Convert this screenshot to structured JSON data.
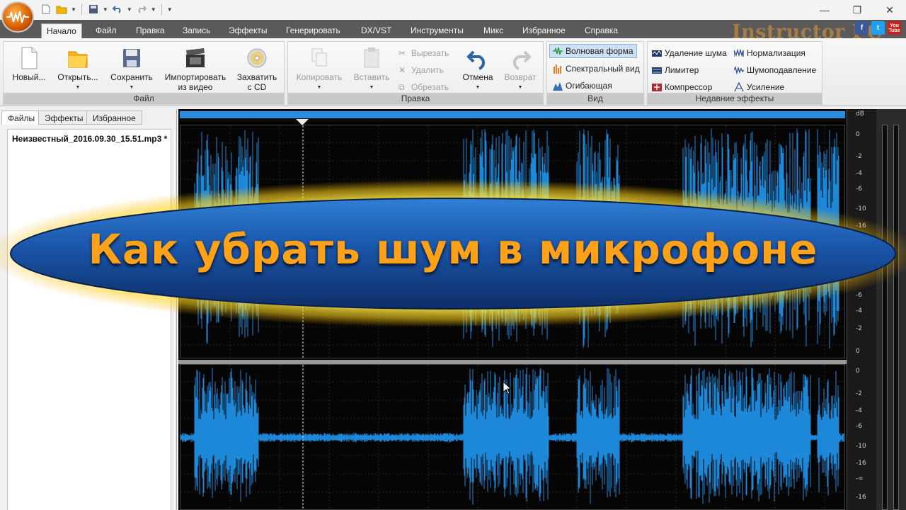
{
  "titlebar": {
    "window_controls": {
      "minimize": "—",
      "restore": "❐",
      "close": "✕"
    }
  },
  "menu": {
    "tabs": [
      "Начало",
      "Файл",
      "Правка",
      "Запись",
      "Эффекты",
      "Генерировать",
      "DX/VST",
      "Инструменты",
      "Микс",
      "Избранное",
      "Справка"
    ],
    "active_tab": "Начало"
  },
  "brand": {
    "text": "Instructor PC",
    "social": [
      "f",
      "t",
      "You\nTube"
    ]
  },
  "ribbon": {
    "file_group": {
      "label": "Файл",
      "buttons": {
        "new": "Новый...",
        "open": "Открыть...",
        "save": "Сохранить",
        "import_video_1": "Импортировать",
        "import_video_2": "из видео",
        "capture_cd_1": "Захватить",
        "capture_cd_2": "с CD"
      }
    },
    "edit_group": {
      "label": "Правка",
      "copy": "Копировать",
      "paste": "Вставить",
      "cut": "Вырезать",
      "delete": "Удалить",
      "trim": "Обрезать",
      "undo": "Отмена",
      "redo": "Возврат"
    },
    "view_group": {
      "label": "Вид",
      "waveform": "Волновая форма",
      "spectral": "Спектральный вид",
      "envelope": "Огибающая"
    },
    "recent_group": {
      "label": "Недавние эффекты",
      "noise_removal": "Удаление шума",
      "limiter": "Лимитер",
      "compressor": "Компрессор",
      "normalization": "Нормализация",
      "noise_gate": "Шумоподавление",
      "amplify": "Усиление"
    }
  },
  "left_panel": {
    "tabs": [
      "Файлы",
      "Эффекты",
      "Избранное"
    ],
    "active_tab": "Файлы",
    "files": [
      "Неизвестный_2016.09.30_15.51.mp3 *"
    ]
  },
  "waveform": {
    "scale_unit": "dB",
    "top_scale": [
      "0",
      "-2",
      "-4",
      "-6",
      "-10",
      "-16",
      "-6",
      "-4",
      "-2",
      "0"
    ],
    "bottom_scale": [
      "0",
      "-2",
      "-4",
      "-6",
      "-10",
      "-16",
      "-∞",
      "-16"
    ],
    "wave_color": "#1e88d8"
  },
  "banner": {
    "title": "Как убрать шум в микрофоне",
    "text_color": "#ffa21a",
    "fill_color": "#1a55a8",
    "glow_color": "#ffe94a"
  }
}
